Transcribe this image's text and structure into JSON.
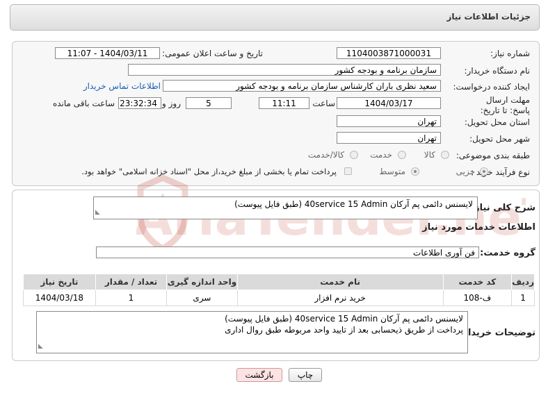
{
  "header": {
    "title": "جزئیات اطلاعات نیاز"
  },
  "form": {
    "need_number_label": "شماره نیاز:",
    "need_number": "1104003871000031",
    "announce_label": "تاریخ و ساعت اعلان عمومی:",
    "announce_value": "1404/03/11 - 11:07",
    "buyer_label": "نام دستگاه خریدار:",
    "buyer_value": "سازمان برنامه و بودجه کشور",
    "creator_label": "ایجاد کننده درخواست:",
    "creator_value": "سعید نظری باران کارشناس سازمان برنامه و بودجه کشور",
    "contact_link": "اطلاعات تماس خریدار",
    "deadline_label": "مهلت ارسال پاسخ: تا تاریخ:",
    "deadline_date": "1404/03/17",
    "time_label": "ساعت",
    "deadline_time": "11:11",
    "days_value": "5",
    "days_label": "روز و",
    "remaining_time": "23:32:34",
    "remaining_label": "ساعت باقی مانده",
    "province_label": "استان محل تحویل:",
    "province_value": "تهران",
    "city_label": "شهر محل تحویل:",
    "city_value": "تهران",
    "category_label": "طبقه بندی موضوعی:",
    "category_options": [
      "کالا",
      "خدمت",
      "کالا/خدمت"
    ],
    "category_selected": "",
    "process_label": "نوع فرآیند خرید :",
    "process_options": [
      "جزیی",
      "متوسط"
    ],
    "process_selected": "جزیی",
    "payment_text": "پرداخت تمام یا بخشی از مبلغ خرید،از محل \"اسناد خزانه اسلامی\" خواهد بود."
  },
  "summary": {
    "label": "شرح کلی نیاز:",
    "text": "لایسنس دائمی پم آرکان 40service 15 Admin (طبق فایل پیوست)"
  },
  "services": {
    "section_title": "اطلاعات خدمات مورد نیاز",
    "group_label": "گروه خدمت:",
    "group_value": "فن آوری اطلاعات",
    "columns": [
      "ردیف",
      "کد خدمت",
      "نام خدمت",
      "واحد اندازه گیری",
      "تعداد / مقدار",
      "تاریخ نیاز"
    ],
    "rows": [
      [
        "1",
        "ف-108",
        "خرید نرم افزار",
        "سری",
        "1",
        "1404/03/18"
      ]
    ]
  },
  "buyer_notes": {
    "label": "توضیحات خریدار:",
    "line1": "لایسنس دائمی پم آرکان 40service 15 Admin (طبق فایل پیوست)",
    "line2": "پرداخت از طریق ذیحسابی بعد از تایید واحد مربوطه طبق روال اداری"
  },
  "buttons": {
    "print": "چاپ",
    "back": "بازگشت"
  },
  "watermark": {
    "text": "AriaTender.neT"
  }
}
